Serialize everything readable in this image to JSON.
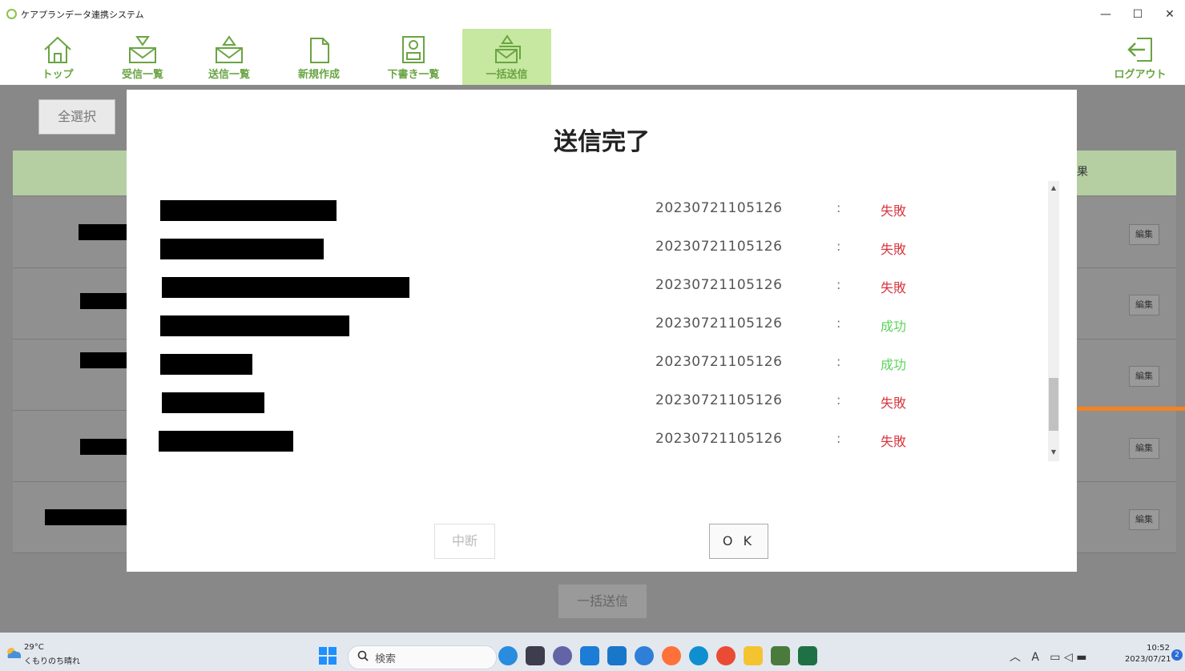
{
  "window": {
    "title": "ケアプランデータ連携システム",
    "minimize": "—",
    "maximize": "☐",
    "close": "✕"
  },
  "toolbar": {
    "items": [
      {
        "label": "トップ",
        "icon": "home-icon"
      },
      {
        "label": "受信一覧",
        "icon": "inbox-icon"
      },
      {
        "label": "送信一覧",
        "icon": "outbox-icon"
      },
      {
        "label": "新規作成",
        "icon": "new-document-icon"
      },
      {
        "label": "下書き一覧",
        "icon": "drafts-icon"
      },
      {
        "label": "一括送信",
        "icon": "bulk-send-icon",
        "active": true
      }
    ],
    "logout": {
      "label": "ログアウト",
      "icon": "logout-icon"
    }
  },
  "background": {
    "select_all": "全選択",
    "header_fragment": "果",
    "edit_label": "編集",
    "bulk_send": "一括送信"
  },
  "dialog": {
    "title": "送信完了",
    "rows": [
      {
        "timestamp": "20230721105126",
        "separator": ":",
        "result": "失敗",
        "status": "fail"
      },
      {
        "timestamp": "20230721105126",
        "separator": ":",
        "result": "失敗",
        "status": "fail"
      },
      {
        "timestamp": "20230721105126",
        "separator": ":",
        "result": "失敗",
        "status": "fail"
      },
      {
        "timestamp": "20230721105126",
        "separator": ":",
        "result": "成功",
        "status": "success"
      },
      {
        "timestamp": "20230721105126",
        "separator": ":",
        "result": "成功",
        "status": "success"
      },
      {
        "timestamp": "20230721105126",
        "separator": ":",
        "result": "失敗",
        "status": "fail"
      },
      {
        "timestamp": "20230721105126",
        "separator": ":",
        "result": "失敗",
        "status": "fail"
      }
    ],
    "stop_button": "中断",
    "ok_button": "O K"
  },
  "taskbar": {
    "weather_temp": "29°C",
    "weather_desc": "くもりのち晴れ",
    "search_placeholder": "検索",
    "time": "10:52",
    "date": "2023/07/21",
    "notification_count": "2",
    "ime_label": "A"
  },
  "colors": {
    "accent_green": "#6aa443",
    "active_tab": "#c7e8a0",
    "fail": "#d9363e",
    "success": "#5bd35b",
    "annotation_orange": "#f5821f"
  }
}
